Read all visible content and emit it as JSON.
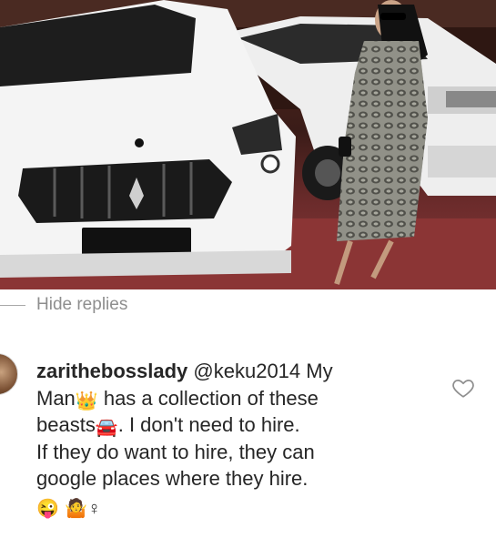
{
  "replies": {
    "hide_label": "Hide replies"
  },
  "comment": {
    "username": "zarithebosslady",
    "mention": "@keku2014",
    "lines": [
      "My",
      "Man",
      "has a collection of these",
      "beasts",
      ". I don't need to hire.",
      "If they do want to hire, they can",
      "google places where they hire."
    ],
    "emoji_crown": "👑",
    "emoji_car": "🚘",
    "emoji_wink": "😜",
    "emoji_shrug": "🤷",
    "emoji_female": "♀"
  },
  "colors": {
    "text": "#262626",
    "muted": "#8e8e8e"
  }
}
